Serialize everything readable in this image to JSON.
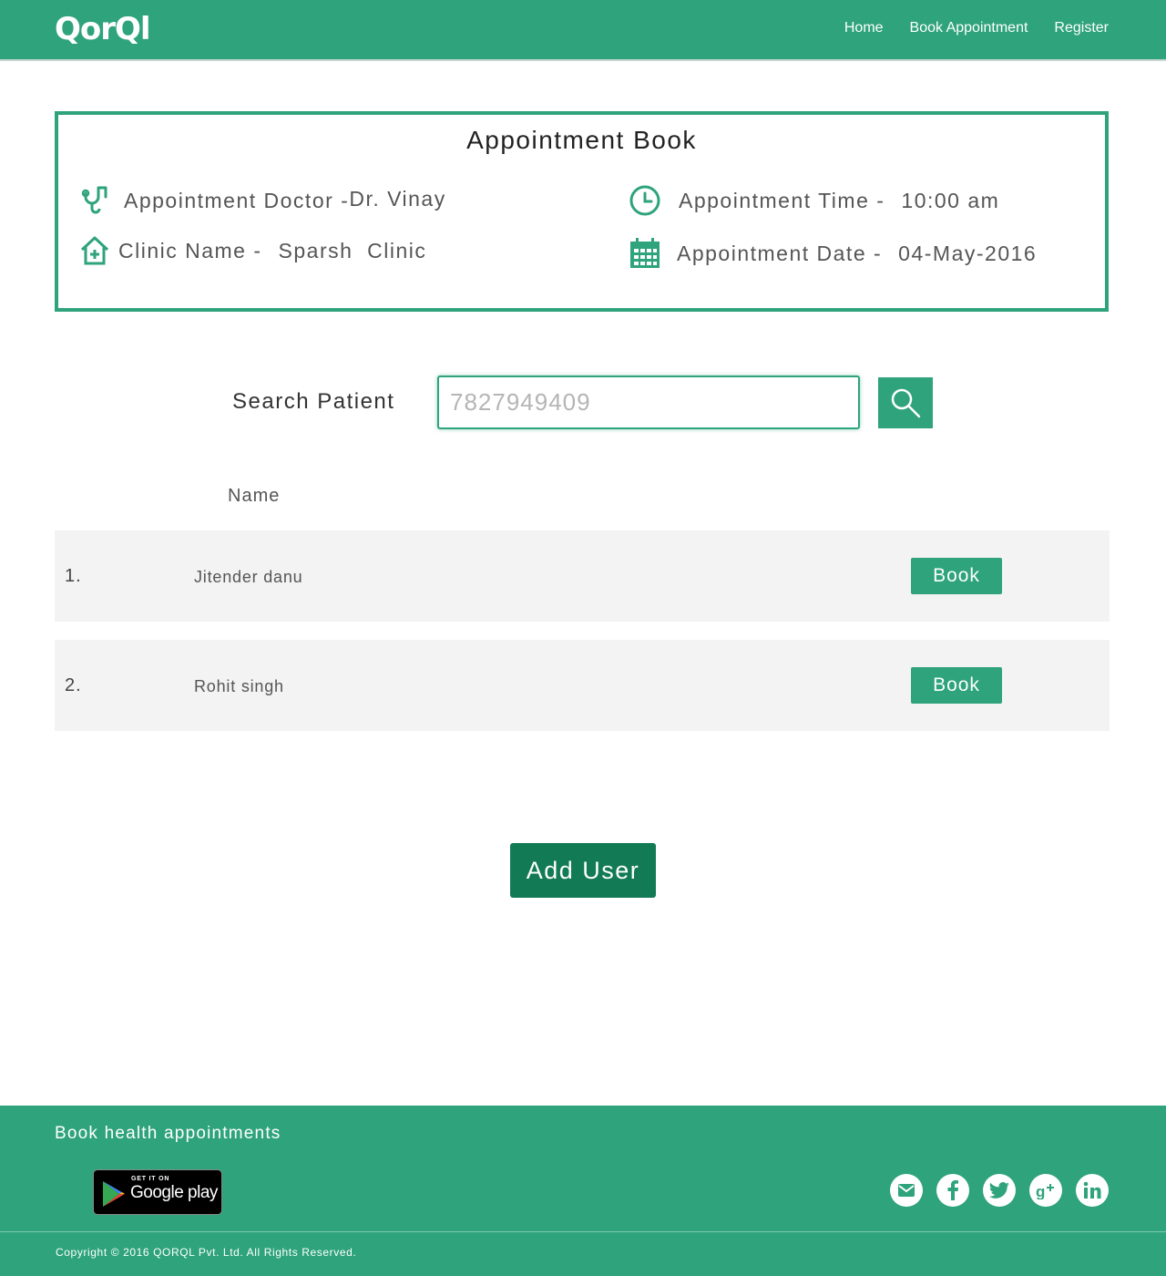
{
  "header": {
    "logo": "QorQl",
    "nav": [
      {
        "label": "Home"
      },
      {
        "label": "Book Appointment"
      },
      {
        "label": "Register"
      }
    ]
  },
  "appointment": {
    "title": "Appointment Book",
    "doctor_label": "Appointment Doctor -",
    "doctor_value": "Dr. Vinay",
    "clinic_label": "Clinic Name -",
    "clinic_value": "Sparsh  Clinic",
    "time_label": "Appointment Time -",
    "time_value": "10:00 am",
    "date_label": "Appointment Date -",
    "date_value": "04-May-2016"
  },
  "search": {
    "label": "Search Patient",
    "placeholder": "7827949409",
    "value": ""
  },
  "table": {
    "column_name": "Name",
    "rows": [
      {
        "num": "1.",
        "name": "Jitender danu",
        "action": "Book"
      },
      {
        "num": "2.",
        "name": "Rohit singh",
        "action": "Book"
      }
    ]
  },
  "add_user_label": "Add User",
  "footer": {
    "tagline": "Book health appointments",
    "gplay_small": "GET IT ON",
    "gplay_big": "Google play",
    "socials": [
      "email-icon",
      "facebook-icon",
      "twitter-icon",
      "google-plus-icon",
      "linkedin-icon"
    ],
    "copyright": "Copyright © 2016 QORQL Pvt. Ltd. All Rights Reserved."
  },
  "colors": {
    "brand": "#2ea37c",
    "brand_dark": "#127a55",
    "row_bg": "#f3f3f3"
  }
}
